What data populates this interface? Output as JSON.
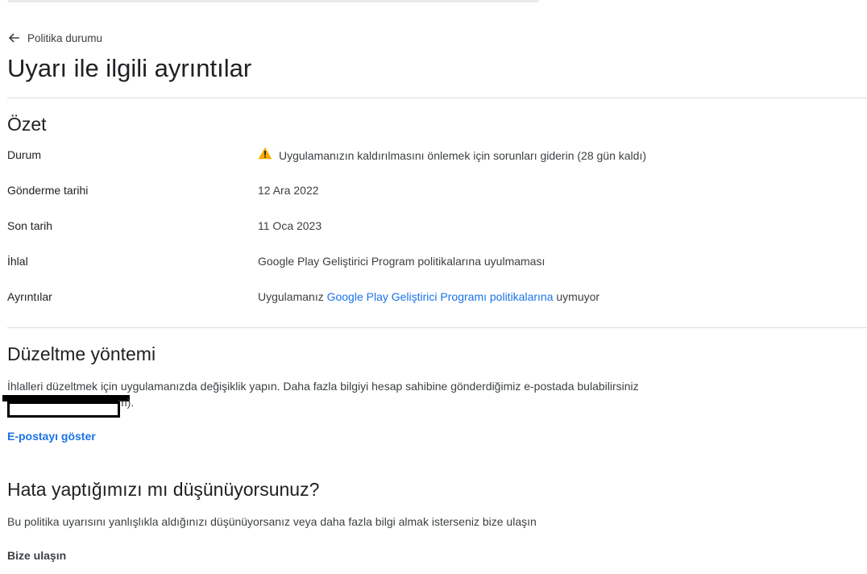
{
  "back_link": {
    "label": "Politika durumu",
    "icon": "arrow-left-icon"
  },
  "page_title": "Uyarı ile ilgili ayrıntılar",
  "summary": {
    "title": "Özet",
    "rows": [
      {
        "label": "Durum",
        "value": "Uygulamanızın kaldırılmasını önlemek için sorunları giderin (28 gün kaldı)",
        "icon": "warning-icon"
      },
      {
        "label": "Gönderme tarihi",
        "value": "12 Ara 2022"
      },
      {
        "label": "Son tarih",
        "value": "11 Oca 2023"
      },
      {
        "label": "İhlal",
        "value": "Google Play Geliştirici Program politikalarına uyulmaması"
      },
      {
        "label": "Ayrıntılar",
        "value_prefix": "Uygulamanız ",
        "value_link": "Google Play Geliştirici Programı politikalarına",
        "value_suffix": " uymuyor"
      }
    ]
  },
  "fix": {
    "title": "Düzeltme yöntemi",
    "description": "İhlalleri düzeltmek için uygulamanızda değişiklik yapın. Daha fazla bilgiyi hesap sahibine gönderdiğimiz e-postada bulabilirsiniz",
    "email_tail": "m).",
    "show_email_label": "E-postayı göster"
  },
  "mistake": {
    "title": "Hata yaptığımızı mı düşünüyorsunuz?",
    "description": "Bu politika uyarısını yanlışlıkla aldığınızı düşünüyorsanız veya daha fazla bilgi almak isterseniz bize ulaşın",
    "contact_label": "Bize ulaşın"
  },
  "colors": {
    "link": "#1a73e8",
    "warning": "#f9ab00",
    "text": "#202124",
    "secondary_text": "#3c4043",
    "divider": "#dadce0"
  }
}
